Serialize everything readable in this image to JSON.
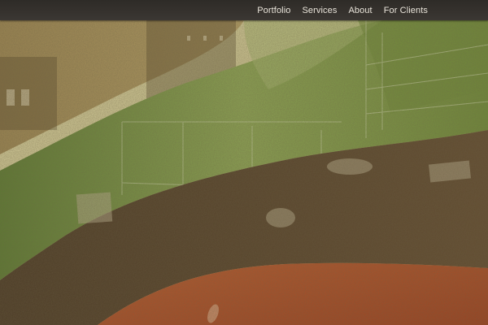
{
  "nav": {
    "items": [
      {
        "label": "Portfolio"
      },
      {
        "label": "Services"
      },
      {
        "label": "About"
      },
      {
        "label": "For Clients"
      }
    ]
  },
  "hero": {
    "image": "collage-background-illustration",
    "band_colors": {
      "sky": "#cfc79b",
      "upper_left": "#a89058",
      "green_band": "#7f9a4a",
      "brown_band": "#5e4a2f",
      "orange_band": "#b2512a"
    }
  }
}
